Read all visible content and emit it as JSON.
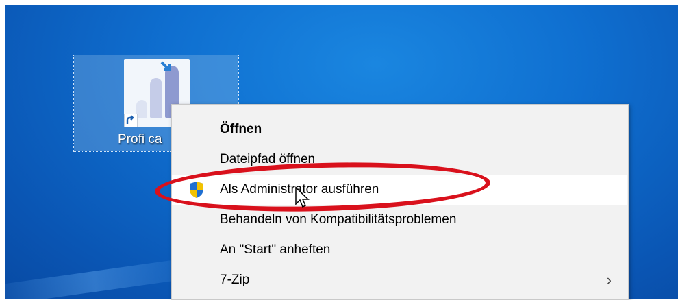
{
  "desktop": {
    "icon": {
      "name": "Profi ca",
      "icon_name": "bar-chart-app-icon"
    }
  },
  "context_menu": {
    "items": [
      {
        "label": "Öffnen",
        "bold": true
      },
      {
        "label": "Dateipfad öffnen"
      },
      {
        "label": "Als Administrator ausführen",
        "icon": "uac-shield-icon",
        "highlighted": true
      },
      {
        "label": "Behandeln von Kompatibilitätsproblemen"
      },
      {
        "label": "An \"Start\" anheften"
      },
      {
        "label": "7-Zip",
        "submenu": true,
        "submenu_icon": "chevron-right-icon"
      }
    ]
  },
  "annotation": {
    "type": "red-ellipse",
    "color": "#d9111c",
    "target": "Als Administrator ausführen"
  },
  "colors": {
    "desktop_blue": "#0f6fd0",
    "menu_bg": "#f2f2f2",
    "highlight_bg": "#ffffff",
    "annotation_red": "#d9111c"
  }
}
